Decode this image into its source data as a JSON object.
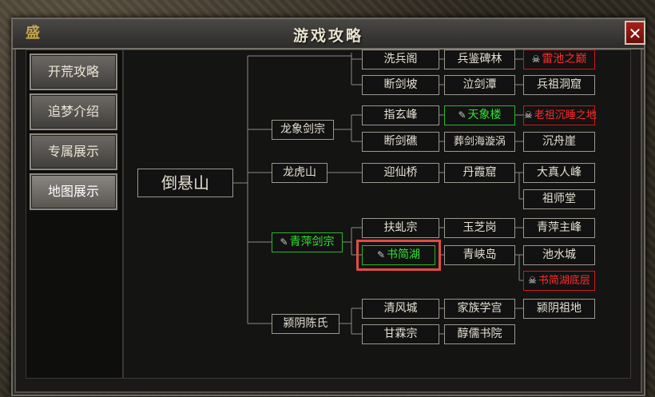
{
  "window": {
    "title": "游戏攻略",
    "close_label": "✕",
    "logo_text": "盛"
  },
  "sidebar": {
    "items": [
      {
        "label": "开荒攻略",
        "active": false
      },
      {
        "label": "追梦介绍",
        "active": false
      },
      {
        "label": "专属展示",
        "active": false
      },
      {
        "label": "地图展示",
        "active": true
      }
    ]
  },
  "map": {
    "root": "倒悬山",
    "regions": {
      "longxiang": "龙象剑宗",
      "longhu": "龙虎山",
      "qingping": "青萍剑宗",
      "yingyin": "颍阴陈氏"
    },
    "nodes": {
      "xibingge": "洗兵阁",
      "bingjianbeilin": "兵鉴碑林",
      "leichizhidian": "雷池之巅",
      "duanjianpo": "断剑坡",
      "qijiantan": "泣剑潭",
      "bingzudongku": "兵祖洞窟",
      "zhixuanfeng": "指玄峰",
      "tianxianglou": "天象楼",
      "laozuchenshui": "老祖沉睡之地",
      "duanjianjiao": "断剑礁",
      "zangjianhai": "葬剑海漩涡",
      "chenzhouya": "沉舟崖",
      "yingxianqiao": "迎仙桥",
      "danxiaku": "丹霞窟",
      "dazhenrenfeng": "大真人峰",
      "zushitang": "祖师堂",
      "fuyouzong": "扶虬宗",
      "yuzhigang": "玉芝岗",
      "qingpingzhufeng": "青萍主峰",
      "shujianhu": "书简湖",
      "qingxiadao": "青峡岛",
      "chishuicheng": "池水城",
      "shujianhudiceng": "书简湖底层",
      "qingfengcheng": "清风城",
      "jiazuxuegong": "家族学宫",
      "yingyinzudi": "颍阴祖地",
      "ganlinzong": "甘霖宗",
      "chunrushuyuan": "醇儒书院"
    }
  },
  "icons": {
    "scroll": "scroll-icon",
    "skull": "skull-icon"
  },
  "colors": {
    "green": "#2ee52e",
    "red": "#ff2b2b",
    "highlight": "#e24b45"
  }
}
